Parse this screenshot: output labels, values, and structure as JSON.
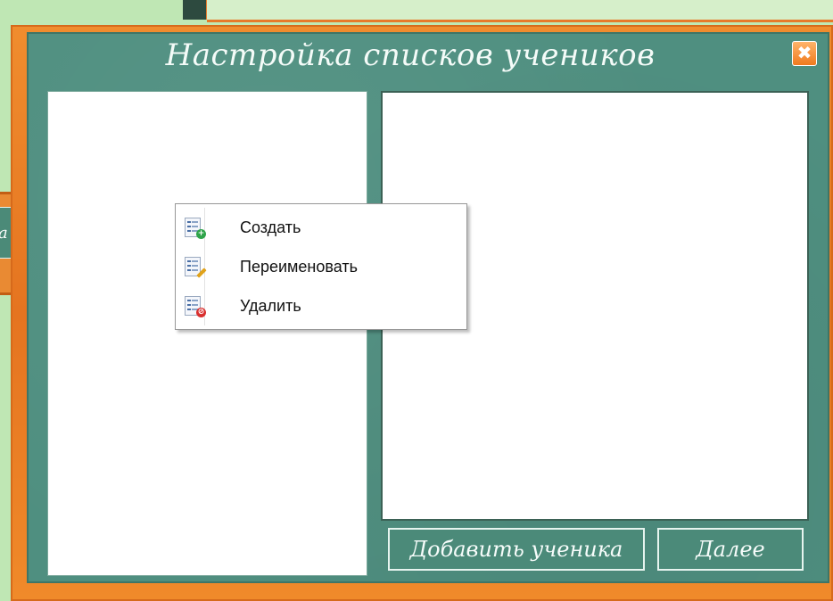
{
  "background": {
    "left_panel_text": "а"
  },
  "dialog": {
    "title": "Настройка списков учеников",
    "close_symbol": "✖"
  },
  "context_menu": {
    "items": [
      {
        "label": "Создать",
        "icon": "list-add-icon"
      },
      {
        "label": "Переименовать",
        "icon": "list-edit-icon"
      },
      {
        "label": "Удалить",
        "icon": "list-delete-icon"
      }
    ]
  },
  "buttons": {
    "add_student": "Добавить ученика",
    "next": "Далее"
  },
  "colors": {
    "board": "#4f8f80",
    "frame": "#e57420",
    "accent": "#f07a1e"
  }
}
